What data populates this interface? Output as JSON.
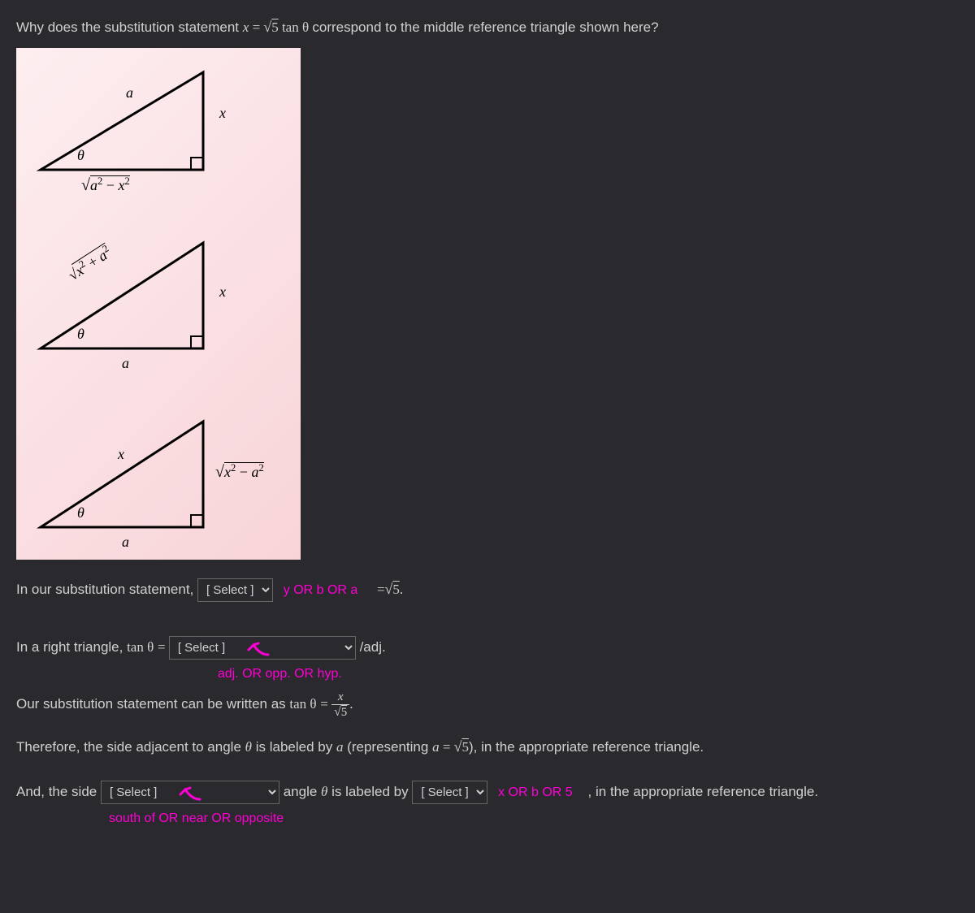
{
  "question": {
    "prefix": "Why does the substitution statement ",
    "equation_lhs": "x",
    "equation_rhs_sqrt": "5",
    "equation_rhs_trig": "tan θ",
    "suffix": " correspond to the middle reference triangle shown here?"
  },
  "triangles": {
    "t1": {
      "hyp": "a",
      "opp": "x",
      "theta": "θ",
      "adj": "√(a² − x²)"
    },
    "t2": {
      "hyp": "√(x² + a²)",
      "opp": "x",
      "theta": "θ",
      "adj": "a"
    },
    "t3": {
      "hyp": "x",
      "opp": "√(x² − a²)",
      "theta": "θ",
      "adj": "a"
    }
  },
  "line1": {
    "prefix": "In our substitution statement, ",
    "select_placeholder": "[ Select ]",
    "annot": "y OR b OR a",
    "suffix_eq": "=",
    "suffix_sqrt": "5",
    "suffix_end": "."
  },
  "line2": {
    "prefix": "In a right triangle, ",
    "trig": "tan θ",
    "eq": " = ",
    "select_placeholder": "[ Select ]",
    "suffix": "/adj.",
    "annot": "adj. OR opp. OR hyp."
  },
  "line3": {
    "text": "Our substitution statement can be written as ",
    "trig": "tan θ",
    "eq": " = ",
    "frac_num": "x",
    "frac_den_sqrt": "5",
    "end": "."
  },
  "line4": {
    "p1": "Therefore, the side adjacent to angle ",
    "theta": "θ",
    "p2": " is labeled by ",
    "a": "a",
    "p3": " (representing ",
    "a2": "a",
    "eq": " = ",
    "sqrt": "5",
    "p4": "), in the appropriate reference triangle."
  },
  "line5": {
    "p1": "And, the side ",
    "select1_placeholder": "[ Select ]",
    "annot1": "south of OR near OR opposite",
    "p2": " angle ",
    "theta": "θ",
    "p3": " is labeled by ",
    "select2_placeholder": "[ Select ]",
    "annot2": "x OR b OR 5",
    "p4": " , in the appropriate reference triangle."
  }
}
